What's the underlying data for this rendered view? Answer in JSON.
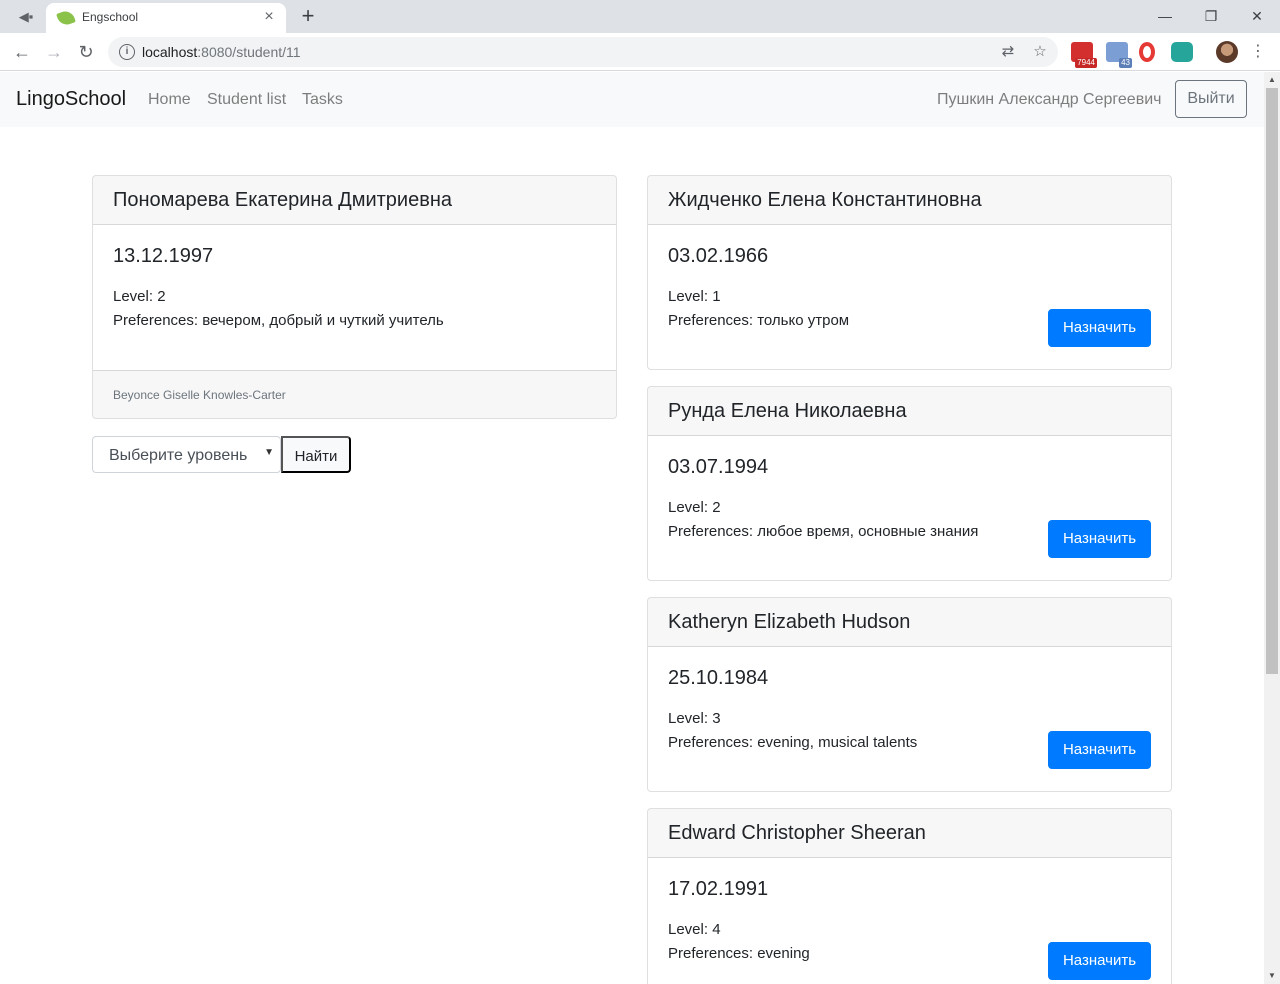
{
  "browser": {
    "tab_title": "Engschool",
    "url_host": "localhost",
    "url_rest": ":8080/student/11",
    "ext_badges": [
      "7944",
      "43"
    ]
  },
  "navbar": {
    "brand": "LingoSchool",
    "links": [
      "Home",
      "Student list",
      "Tasks"
    ],
    "user_name": "Пушкин Александр Сергеевич",
    "logout_label": "Выйти"
  },
  "student": {
    "name": "Пономарева Екатерина Дмитриевна",
    "birth_date": "13.12.1997",
    "level": "Level: 2",
    "preferences": "Preferences: вечером, добрый и чуткий учитель",
    "teacher": "Beyonce Giselle Knowles-Carter"
  },
  "filter": {
    "select_value": "Выберите уровень",
    "find_label": "Найти"
  },
  "teachers": [
    {
      "name": "Жидченко Елена Константиновна",
      "birth_date": "03.02.1966",
      "level": "Level: 1",
      "preferences": "Preferences: только утром",
      "button": "Назначить"
    },
    {
      "name": "Рунда Елена Николаевна",
      "birth_date": "03.07.1994",
      "level": "Level: 2",
      "preferences": "Preferences: любое время, основные знания",
      "button": "Назначить"
    },
    {
      "name": "Katheryn Elizabeth Hudson",
      "birth_date": "25.10.1984",
      "level": "Level: 3",
      "preferences": "Preferences: evening, musical talents",
      "button": "Назначить"
    },
    {
      "name": "Edward Christopher Sheeran",
      "birth_date": "17.02.1991",
      "level": "Level: 4",
      "preferences": "Preferences: evening",
      "button": "Назначить"
    }
  ],
  "colors": {
    "primary": "#007bff",
    "navbar_bg": "#f8f9fa"
  }
}
